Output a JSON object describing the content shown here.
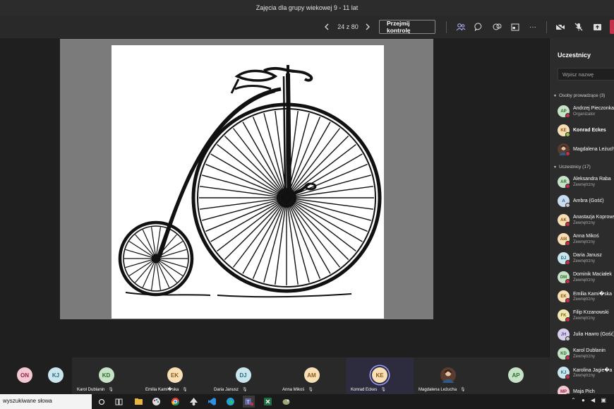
{
  "window": {
    "title": "Zajęcia dla grupy wiekowej 9 - 11 lat"
  },
  "toolbar": {
    "page_counter": "24 z 80",
    "take_control_label": "Przejmij kontrolę",
    "more_label": "···"
  },
  "panel": {
    "title": "Uczestnicy",
    "search_placeholder": "Wpisz nazwę",
    "presenters_header": "Osoby prowadzące (3)",
    "attendees_header": "Uczestnicy (17)",
    "presenters": [
      {
        "initials": "AP",
        "name": "Andrzej Pieczonka",
        "role": "Organizator",
        "bg": "#c7e3c7",
        "fg": "#2f6b2f",
        "status": "#c4314b"
      },
      {
        "initials": "KE",
        "name": "Konrad Eckes",
        "role": "",
        "bg": "#f8dfb5",
        "fg": "#8a5a16",
        "status": "#92c353"
      },
      {
        "initials": "",
        "name": "Magdalena Leżucha",
        "role": "",
        "bg": "#5a3c30",
        "fg": "#fff",
        "status": "#c4314b"
      }
    ],
    "attendees": [
      {
        "initials": "AR",
        "name": "Aleksandra Raba",
        "role": "Zewnętrzny",
        "bg": "#c7e3c7",
        "fg": "#2f6b2f",
        "status": "#c4314b"
      },
      {
        "initials": "A",
        "name": "Ambra (Gość)",
        "role": "",
        "bg": "#c9dcf0",
        "fg": "#2b5b8a",
        "status": "#c8c8c8"
      },
      {
        "initials": "AK",
        "name": "Anastazja Koprowska",
        "role": "Zewnętrzny",
        "bg": "#f8dfb5",
        "fg": "#8a5a16",
        "status": "#c4314b"
      },
      {
        "initials": "AM",
        "name": "Anna Mikoś",
        "role": "Zewnętrzny",
        "bg": "#f8dfb5",
        "fg": "#8a5a16",
        "status": "#c4314b"
      },
      {
        "initials": "DJ",
        "name": "Daria Janusz",
        "role": "Zewnętrzny",
        "bg": "#c9e6ee",
        "fg": "#2b6b7a",
        "status": "#c4314b"
      },
      {
        "initials": "DM",
        "name": "Dominik Maciałek",
        "role": "Zewnętrzny",
        "bg": "#c7e3c7",
        "fg": "#2f6b2f",
        "status": "#c4314b"
      },
      {
        "initials": "EK",
        "name": "Emilia Kami�ska",
        "role": "Zewnętrzny",
        "bg": "#f8dfb5",
        "fg": "#8a5a16",
        "status": "#c4314b"
      },
      {
        "initials": "FK",
        "name": "Filip Krzanowski",
        "role": "Zewnętrzny",
        "bg": "#f3e9b5",
        "fg": "#7a6a16",
        "status": "#c4314b"
      },
      {
        "initials": "JH",
        "name": "Julia Hawro (Gość)",
        "role": "",
        "bg": "#d9d0ee",
        "fg": "#5b4b8a",
        "status": "#c8c8c8"
      },
      {
        "initials": "KD",
        "name": "Karol Dublanin",
        "role": "Zewnętrzny",
        "bg": "#c7e3c7",
        "fg": "#2f6b2f",
        "status": "#c4314b"
      },
      {
        "initials": "KJ",
        "name": "Karolina Jagie�a",
        "role": "Zewnętrzny",
        "bg": "#c9e6ee",
        "fg": "#2b6b7a",
        "status": "#c4314b"
      },
      {
        "initials": "MP",
        "name": "Maja Pich",
        "role": "",
        "bg": "#f4c7d3",
        "fg": "#8a2b47",
        "status": "#c4314b"
      }
    ]
  },
  "strip": [
    {
      "initials": "ON",
      "name": "",
      "bg": "#f4c7d3",
      "fg": "#8a2b47"
    },
    {
      "initials": "KJ",
      "name": "",
      "bg": "#c9e6ee",
      "fg": "#2b6b7a"
    },
    {
      "initials": "KD",
      "name": "Karol Dublanin",
      "bg": "#c7e3c7",
      "fg": "#2f6b2f"
    },
    {
      "initials": "EK",
      "name": "Emilia Kami�ska",
      "bg": "#f8dfb5",
      "fg": "#8a5a16"
    },
    {
      "initials": "DJ",
      "name": "Daria Janusz",
      "bg": "#c9e6ee",
      "fg": "#2b6b7a"
    },
    {
      "initials": "AM",
      "name": "Anna Mikoś",
      "bg": "#f8dfb5",
      "fg": "#8a5a16"
    },
    {
      "initials": "KE",
      "name": "Konrad Eckes",
      "bg": "#f8dfb5",
      "fg": "#8a5a16"
    },
    {
      "initials": "",
      "name": "Magdalena Leżucha",
      "bg": "#5a3c30",
      "fg": "#fff"
    },
    {
      "initials": "AP",
      "name": "",
      "bg": "#c7e3c7",
      "fg": "#2f6b2f"
    }
  ],
  "taskbar": {
    "search_text": "wyszukiwane słowa"
  },
  "colors": {
    "accent": "#6264a7",
    "leave": "#c4314b",
    "panel_bg": "#2d2c2c"
  }
}
